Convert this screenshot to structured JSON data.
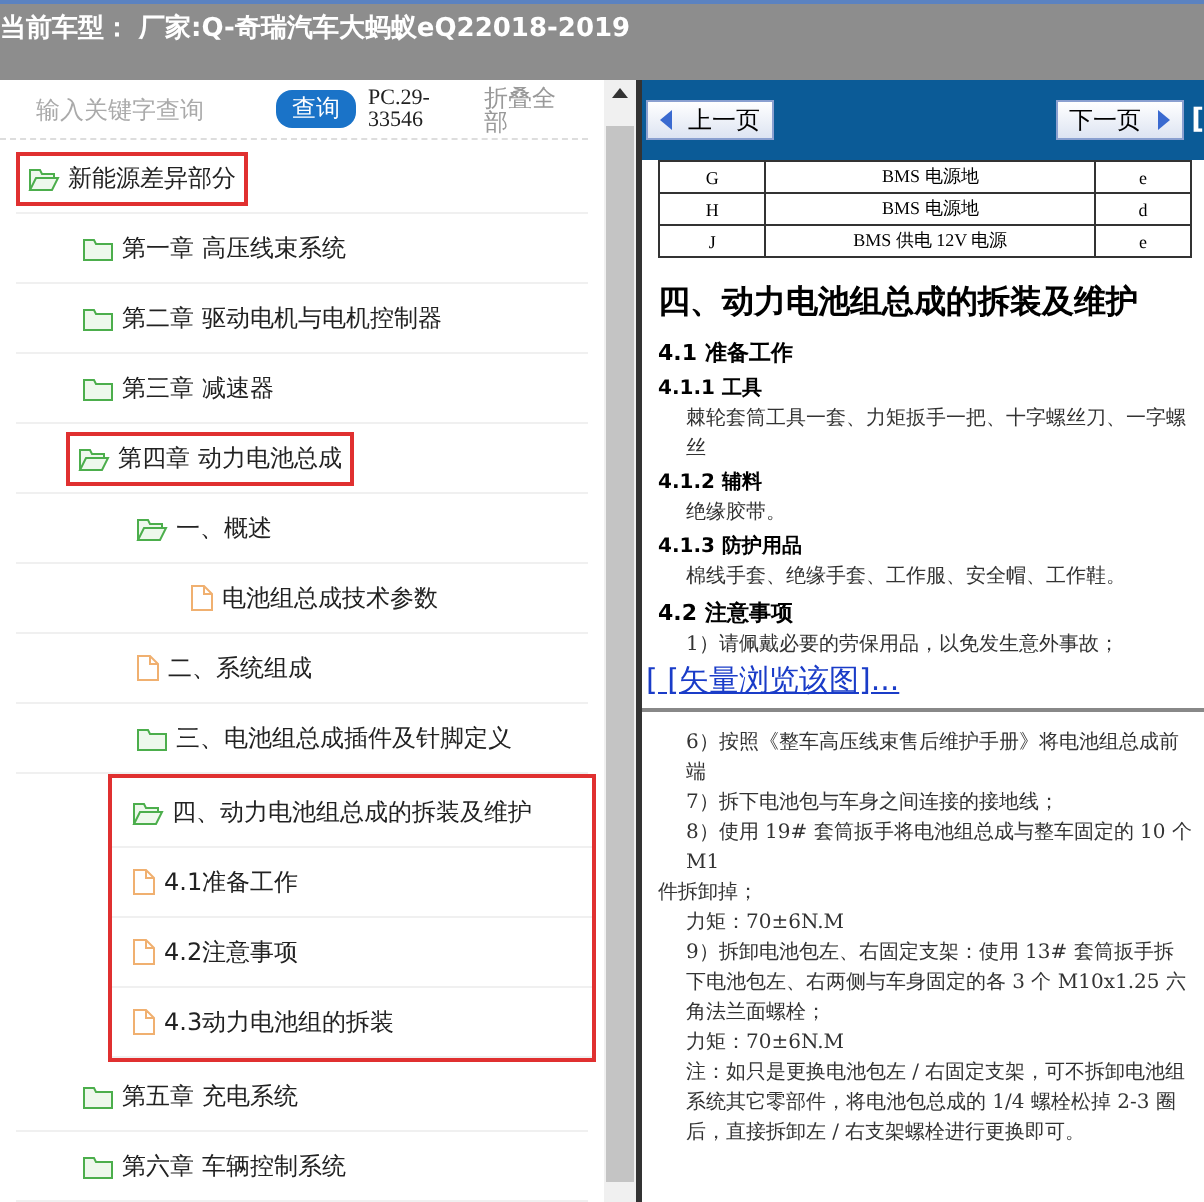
{
  "header": {
    "title": "当前车型：  厂家:Q-奇瑞汽车大蚂蚁eQ22018-2019"
  },
  "search": {
    "placeholder": "输入关键字查询",
    "button": "查询",
    "code": "PC.29-33546",
    "collapse": "折叠全部"
  },
  "tree": [
    {
      "label": "新能源差异部分",
      "kind": "folder",
      "expanded": true,
      "highlighted": true,
      "children": [
        {
          "label": "第一章 高压线束系统",
          "kind": "folder",
          "expanded": false
        },
        {
          "label": "第二章 驱动电机与电机控制器",
          "kind": "folder",
          "expanded": false
        },
        {
          "label": "第三章 减速器",
          "kind": "folder",
          "expanded": false
        },
        {
          "label": "第四章 动力电池总成",
          "kind": "folder",
          "expanded": true,
          "highlighted": true,
          "children": [
            {
              "label": "一、概述",
              "kind": "folder",
              "expanded": true,
              "children": [
                {
                  "label": "电池组总成技术参数",
                  "kind": "file"
                }
              ]
            },
            {
              "label": "二、系统组成",
              "kind": "file"
            },
            {
              "label": "三、电池组总成插件及针脚定义",
              "kind": "folder",
              "expanded": false
            },
            {
              "label": "四、动力电池组总成的拆装及维护",
              "kind": "folder",
              "expanded": true,
              "highlighted": true,
              "children": [
                {
                  "label": "4.1准备工作",
                  "kind": "file",
                  "highlighted": true
                },
                {
                  "label": "4.2注意事项",
                  "kind": "file",
                  "highlighted": true
                },
                {
                  "label": "4.3动力电池组的拆装",
                  "kind": "file",
                  "highlighted": true
                }
              ]
            }
          ]
        },
        {
          "label": "第五章 充电系统",
          "kind": "folder",
          "expanded": false
        },
        {
          "label": "第六章 车辆控制系统",
          "kind": "folder",
          "expanded": false
        }
      ]
    }
  ],
  "viewer": {
    "prev": "上一页",
    "next": "下一页",
    "link_fragment": "[",
    "table": [
      [
        "G",
        "BMS 电源地",
        "e"
      ],
      [
        "H",
        "BMS 电源地",
        "d"
      ],
      [
        "J",
        "BMS 供电 12V 电源",
        "e"
      ]
    ],
    "blocks": [
      {
        "kind": "h1",
        "text": "四、动力电池组总成的拆装及维护"
      },
      {
        "kind": "h2",
        "text": "4.1 准备工作"
      },
      {
        "kind": "h3",
        "text": "4.1.1 工具"
      },
      {
        "kind": "p",
        "text": "棘轮套筒工具一套、力矩扳手一把、十字螺丝刀、一字螺丝"
      },
      {
        "kind": "h3",
        "text": "4.1.2 辅料"
      },
      {
        "kind": "p",
        "text": "绝缘胶带。"
      },
      {
        "kind": "h3",
        "text": "4.1.3 防护用品"
      },
      {
        "kind": "p",
        "text": "棉线手套、绝缘手套、工作服、安全帽、工作鞋。"
      },
      {
        "kind": "h2",
        "text": "4.2 注意事项"
      },
      {
        "kind": "p",
        "text": "1）请佩戴必要的劳保用品，以免发生意外事故；"
      },
      {
        "kind": "link",
        "text": "[ [矢量浏览该图]..."
      },
      {
        "kind": "rule"
      },
      {
        "kind": "p",
        "text": "6）按照《整车高压线束售后维护手册》将电池组总成前端"
      },
      {
        "kind": "p",
        "text": "7）拆下电池包与车身之间连接的接地线；"
      },
      {
        "kind": "p",
        "text": "8）使用 19# 套筒扳手将电池组总成与整车固定的 10 个 M1"
      },
      {
        "kind": "p0",
        "text": "件拆卸掉；"
      },
      {
        "kind": "p",
        "text": "力矩：70±6N.M"
      },
      {
        "kind": "p",
        "text": "9）拆卸电池包左、右固定支架：使用 13# 套筒扳手拆下电池包左、右两侧与车身固定的各 3 个 M10x1.25 六角法兰面螺栓；"
      },
      {
        "kind": "p",
        "text": "力矩：70±6N.M"
      },
      {
        "kind": "p",
        "text": "注：如只是更换电池包左 / 右固定支架，可不拆卸电池组系统其它零部件，将电池包总成的 1/4 螺栓松掉 2-3 圈后，直接拆卸左 / 右支架螺栓进行更换即可。"
      }
    ]
  }
}
